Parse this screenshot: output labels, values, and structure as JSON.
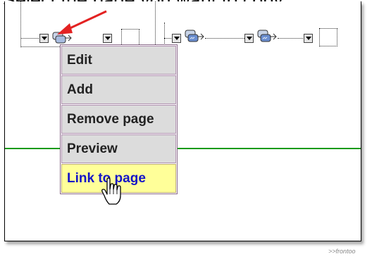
{
  "caption": {
    "text": "Select the page you want to copy."
  },
  "context_menu": {
    "items": [
      {
        "label": "Edit"
      },
      {
        "label": "Add"
      },
      {
        "label": "Remove page"
      },
      {
        "label": "Preview"
      },
      {
        "label": "Link to page",
        "highlighted": true
      }
    ]
  },
  "annotation": {
    "arrow_color": "#e32222",
    "divider_color": "#1a9a1a"
  },
  "icons": {
    "pointer": "red-arrow-icon",
    "cursor": "hand-cursor-icon",
    "dropdown": "dropdown-arrow-icon",
    "page_flow": "page-flow-icon"
  },
  "watermark": {
    "text": ">>frontoo"
  }
}
